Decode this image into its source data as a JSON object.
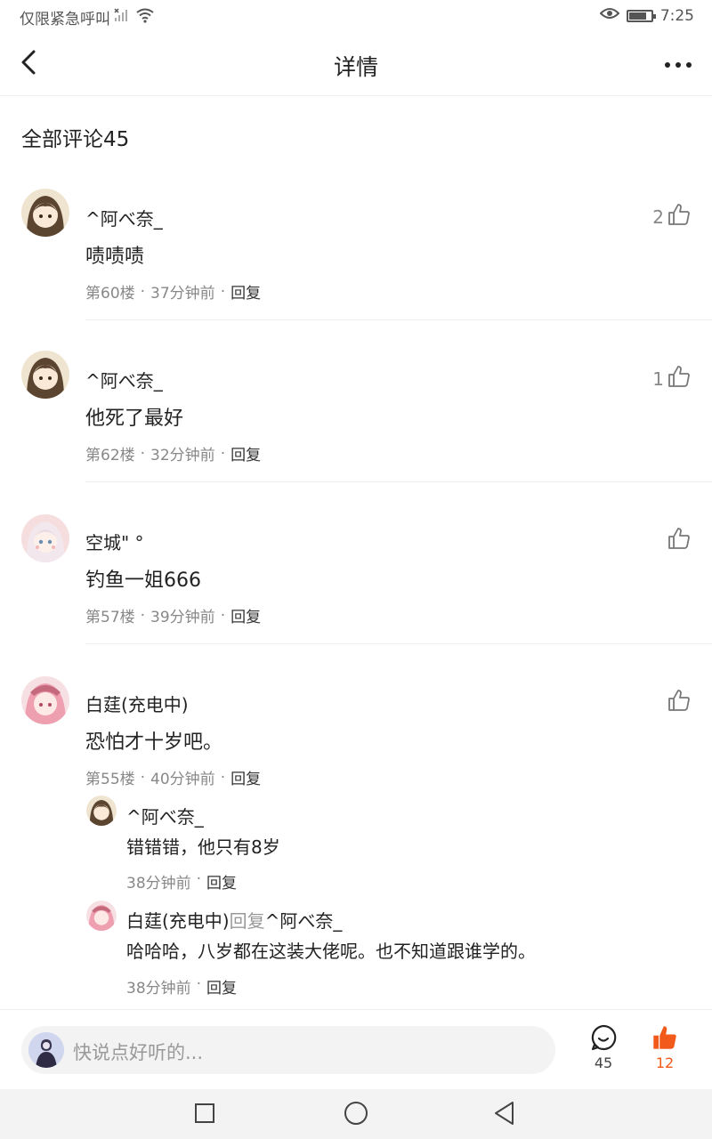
{
  "status_bar": {
    "carrier": "仅限紧急呼叫",
    "time": "7:25",
    "battery_level": 0.8
  },
  "header": {
    "title": "详情",
    "back_icon": "chevron-left-icon",
    "more_icon": "more-dots-icon"
  },
  "section": {
    "title": "全部评论45"
  },
  "comments": [
    {
      "user": "^阿べ奈_",
      "text": "啧啧啧",
      "floor": "第60楼",
      "time": "37分钟前",
      "reply": "回复",
      "likes": "2"
    },
    {
      "user": "^阿べ奈_",
      "text": "他死了最好",
      "floor": "第62楼",
      "time": "32分钟前",
      "reply": "回复",
      "likes": "1"
    },
    {
      "user": "空城\" °",
      "text": "钓鱼一姐666",
      "floor": "第57楼",
      "time": "39分钟前",
      "reply": "回复",
      "likes": ""
    },
    {
      "user": "白莛(充电中)",
      "text": "恐怕才十岁吧。",
      "floor": "第55楼",
      "time": "40分钟前",
      "reply": "回复",
      "likes": ""
    }
  ],
  "sub_replies": [
    {
      "user": "^阿べ奈_",
      "reply_word": "",
      "target": "",
      "text": "错错错，他只有8岁",
      "time": "38分钟前",
      "reply": "回复"
    },
    {
      "user": "白莛(充电中)",
      "reply_word": "回复",
      "target": "^阿べ奈_",
      "text": "哈哈哈，八岁都在这装大佬呢。也不知道跟谁学的。",
      "time": "38分钟前",
      "reply": "回复"
    }
  ],
  "separator": "·",
  "input_bar": {
    "placeholder": "快说点好听的...",
    "comment_count": "45",
    "like_count": "12",
    "accent_color": "#f25a1b"
  }
}
